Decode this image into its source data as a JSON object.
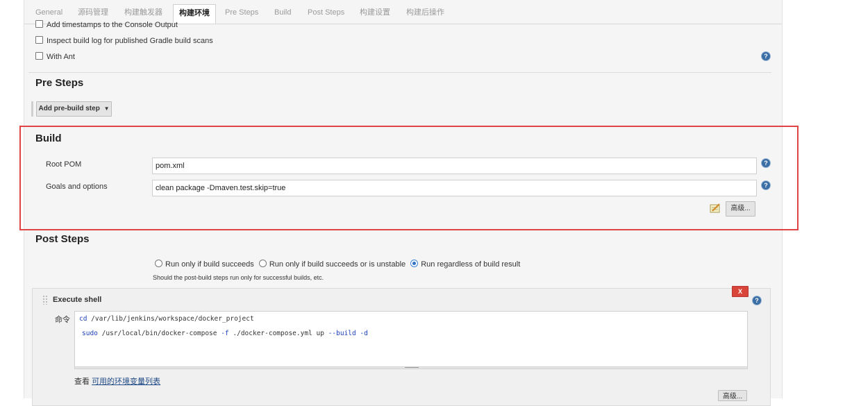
{
  "tabs": [
    "General",
    "源码管理",
    "构建触发器",
    "构建环境",
    "Pre Steps",
    "Build",
    "Post Steps",
    "构建设置",
    "构建后操作"
  ],
  "active_tab": "构建环境",
  "build_env": {
    "options": [
      "Add timestamps to the Console Output",
      "Inspect build log for published Gradle build scans",
      "With Ant"
    ]
  },
  "help_glyph": "?",
  "pre_steps": {
    "title": "Pre Steps",
    "add_button": "Add pre-build step"
  },
  "build": {
    "title": "Build",
    "root_pom_label": "Root POM",
    "root_pom_value": "pom.xml",
    "goals_label": "Goals and options",
    "goals_value": "clean package -Dmaven.test.skip=true",
    "advanced_button": "高级..."
  },
  "post_steps": {
    "title": "Post Steps",
    "radio_options": [
      "Run only if build succeeds",
      "Run only if build succeeds or is unstable",
      "Run regardless of build result"
    ],
    "selected_index": 2,
    "hint": "Should the post-build steps run only for successful builds, etc."
  },
  "execute_shell": {
    "title": "Execute shell",
    "delete_label": "X",
    "command_label": "命令",
    "command_line1_plain": "cd /var/lib/jenkins/workspace/docker_project",
    "command_line2_plain": "sudo /usr/local/bin/docker-compose -f ./docker-compose.yml up --build -d",
    "env_prefix": "查看",
    "env_link": "可用的环境变量列表",
    "advanced_button": "高级..."
  },
  "colors": {
    "highlight_border": "#e04343",
    "delete_button": "#d9443b",
    "help_icon": "#3a6ea5",
    "link": "#204a87"
  }
}
